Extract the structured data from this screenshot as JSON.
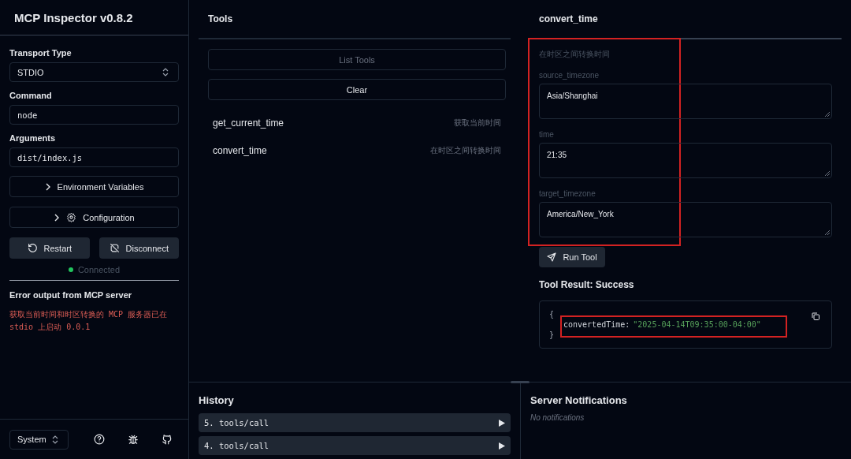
{
  "sidebar": {
    "title": "MCP Inspector v0.8.2",
    "transport_type": {
      "label": "Transport Type",
      "value": "STDIO"
    },
    "command": {
      "label": "Command",
      "value": "node"
    },
    "arguments": {
      "label": "Arguments",
      "value": "dist/index.js"
    },
    "sections": [
      {
        "label": "Environment Variables",
        "kind": "plain",
        "expanded": false
      },
      {
        "label": "Configuration",
        "kind": "settings",
        "expanded": false
      }
    ],
    "buttons": [
      {
        "label": "Restart",
        "kind": "restart"
      },
      {
        "label": "Disconnect",
        "kind": "disconnect"
      }
    ],
    "status": {
      "label": "Connected",
      "connected": true
    },
    "error_output": {
      "title": "Error output from MCP server",
      "text": "获取当前时间和时区转换的 MCP 服务器已在 stdio 上启动 0.0.1"
    },
    "theme": {
      "value": "System"
    }
  },
  "tools": {
    "title": "Tools",
    "list_button": {
      "label": "List Tools",
      "disabled": true
    },
    "clear_button": {
      "label": "Clear"
    },
    "items": [
      {
        "name": "get_current_time",
        "description": "获取当前时间"
      },
      {
        "name": "convert_time",
        "description": "在时区之间转换时间"
      }
    ]
  },
  "tool_detail": {
    "title": "convert_time",
    "description": "在时区之间转换时间",
    "params_highlighted": true,
    "params": [
      {
        "label": "source_timezone",
        "value": "Asia/Shanghai"
      },
      {
        "label": "time",
        "value": "21:35"
      },
      {
        "label": "target_timezone",
        "value": "America/New_York"
      }
    ],
    "run_button": {
      "label": "Run Tool"
    },
    "result": {
      "title": "Tool Result: Success",
      "open": "{",
      "key": "convertedTime:",
      "value": "\"2025-04-14T09:35:00-04:00\"",
      "close": "}",
      "highlighted": true
    }
  },
  "history": {
    "title": "History",
    "items": [
      "5. tools/call",
      "4. tools/call"
    ]
  },
  "notifications": {
    "title": "Server Notifications",
    "empty_text": "No notifications"
  }
}
